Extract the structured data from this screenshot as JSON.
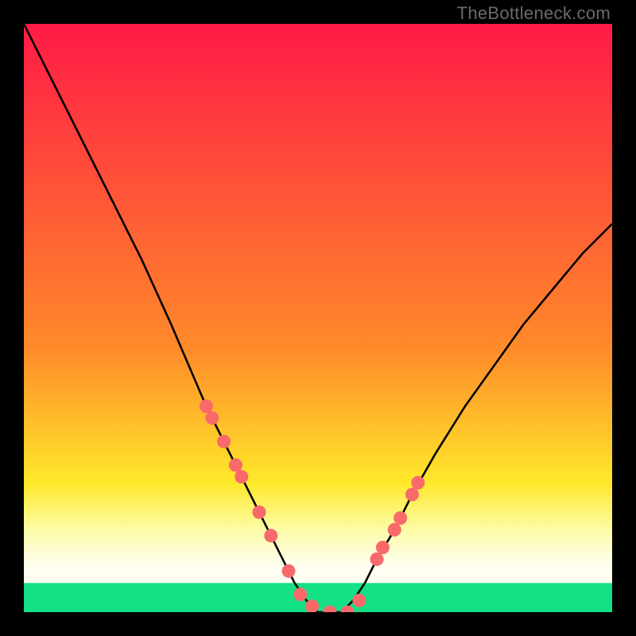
{
  "watermark": "TheBottleneck.com",
  "colors": {
    "top": "#ff1a46",
    "orange": "#ff8a2a",
    "yellow": "#ffe82a",
    "pale": "#fcfca6",
    "cream": "#fffef0",
    "green": "#14e085",
    "curve": "#000000",
    "marker": "#f86a6a"
  },
  "chart_data": {
    "type": "line",
    "title": "",
    "xlabel": "",
    "ylabel": "",
    "xlim": [
      0,
      100
    ],
    "ylim": [
      0,
      100
    ],
    "series": [
      {
        "name": "bottleneck-curve",
        "x": [
          0,
          5,
          10,
          15,
          20,
          25,
          28,
          31,
          34,
          37,
          40,
          42,
          44,
          46,
          48,
          50,
          52,
          54,
          56,
          58,
          60,
          63,
          66,
          70,
          75,
          80,
          85,
          90,
          95,
          100
        ],
        "y": [
          100,
          90,
          80,
          70,
          60,
          49,
          42,
          35,
          29,
          23,
          17,
          13,
          9,
          5,
          2,
          0,
          0,
          0,
          2,
          5,
          9,
          14,
          20,
          27,
          35,
          42,
          49,
          55,
          61,
          66
        ]
      }
    ],
    "markers": {
      "name": "highlighted-points",
      "x": [
        31,
        32,
        34,
        36,
        37,
        40,
        42,
        45,
        47,
        49,
        52,
        55,
        57,
        60,
        61,
        63,
        64,
        66,
        67
      ],
      "y": [
        35,
        33,
        29,
        25,
        23,
        17,
        13,
        7,
        3,
        1,
        0,
        0,
        2,
        9,
        11,
        14,
        16,
        20,
        22
      ]
    },
    "bands": [
      {
        "name": "red-orange",
        "from": 100,
        "to": 30
      },
      {
        "name": "yellow",
        "from": 30,
        "to": 18
      },
      {
        "name": "pale-yellow",
        "from": 18,
        "to": 10
      },
      {
        "name": "cream",
        "from": 10,
        "to": 5
      },
      {
        "name": "green",
        "from": 5,
        "to": 0
      }
    ]
  }
}
